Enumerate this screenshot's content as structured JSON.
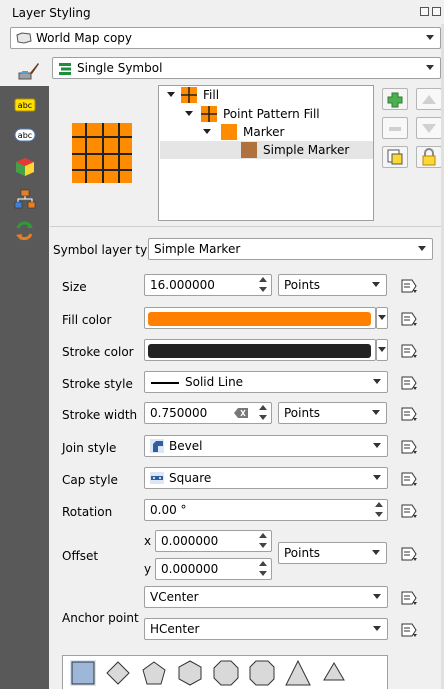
{
  "window": {
    "title": "Layer Styling"
  },
  "layer_select": {
    "value": "World Map copy"
  },
  "renderer_select": {
    "value": "Single Symbol"
  },
  "symbol_tree": {
    "items": [
      {
        "label": "Fill"
      },
      {
        "label": "Point Pattern Fill"
      },
      {
        "label": "Marker"
      },
      {
        "label": "Simple Marker"
      }
    ]
  },
  "symbol_layer_type": {
    "label": "Symbol layer type",
    "value": "Simple Marker"
  },
  "props": {
    "size": {
      "label": "Size",
      "value": "16.000000",
      "unit": "Points"
    },
    "fill_color": {
      "label": "Fill color",
      "color": "#ff8000"
    },
    "stroke_color": {
      "label": "Stroke color",
      "color": "#232323"
    },
    "stroke_style": {
      "label": "Stroke style",
      "value": "Solid Line"
    },
    "stroke_width": {
      "label": "Stroke width",
      "value": "0.750000",
      "unit": "Points"
    },
    "join_style": {
      "label": "Join style",
      "value": "Bevel"
    },
    "cap_style": {
      "label": "Cap style",
      "value": "Square"
    },
    "rotation": {
      "label": "Rotation",
      "value": "0.00 °"
    },
    "offset": {
      "label": "Offset",
      "x_label": "x",
      "x_value": "0.000000",
      "y_label": "y",
      "y_value": "0.000000",
      "unit": "Points"
    },
    "anchor_point": {
      "label": "Anchor point",
      "vertical": "VCenter",
      "horizontal": "HCenter"
    }
  },
  "colors": {
    "accent_orange": "#ff8c00",
    "toolbar_dark": "#595959",
    "selection": "#e5e5e5"
  },
  "icons": {
    "paint": "paintbrush-icon",
    "data_defined": "data-defined-override-icon"
  }
}
